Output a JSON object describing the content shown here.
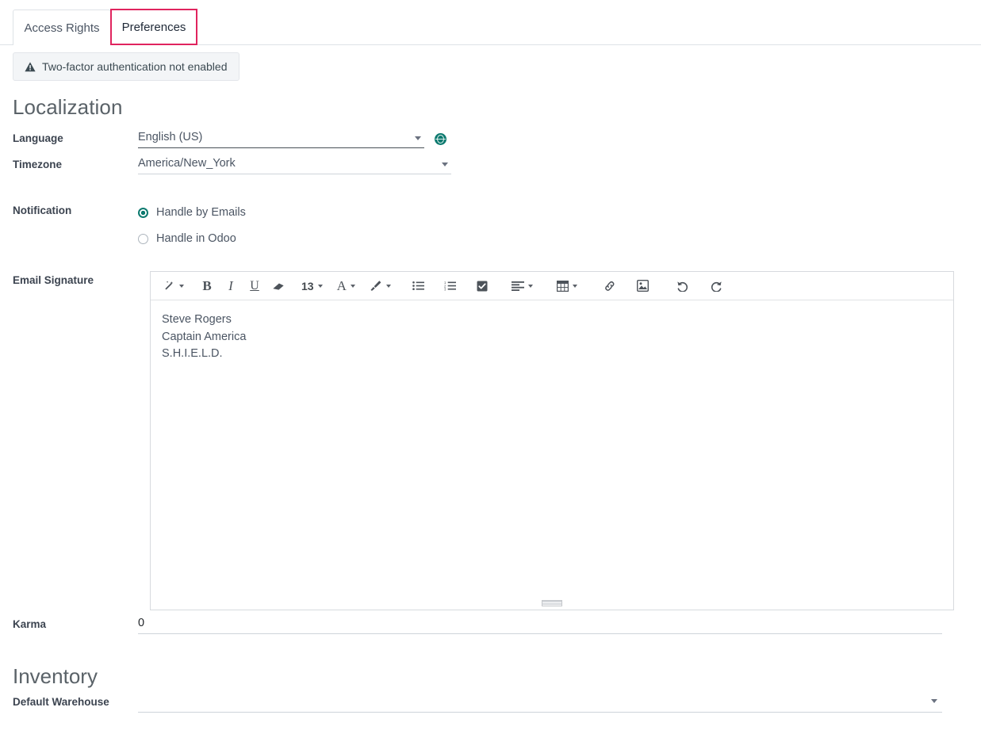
{
  "tabs": [
    {
      "label": "Access Rights",
      "active": false,
      "name": "tab-access-rights"
    },
    {
      "label": "Preferences",
      "active": true,
      "name": "tab-preferences"
    }
  ],
  "twofa": {
    "label": "Two-factor authentication not enabled",
    "icon": "warning-triangle-icon"
  },
  "localization": {
    "title": "Localization",
    "language": {
      "label": "Language",
      "value": "English (US)",
      "icon": "globe-icon"
    },
    "timezone": {
      "label": "Timezone",
      "value": "America/New_York"
    },
    "notification": {
      "label": "Notification",
      "options": [
        {
          "label": "Handle by Emails",
          "selected": true
        },
        {
          "label": "Handle in Odoo",
          "selected": false
        }
      ]
    },
    "email_signature": {
      "label": "Email Signature",
      "lines": [
        "Steve Rogers",
        "Captain America",
        "S.H.I.E.L.D."
      ]
    },
    "karma": {
      "label": "Karma",
      "value": "0"
    }
  },
  "editor_toolbar": {
    "items": [
      {
        "name": "magic-wand-icon",
        "glyph": "✒",
        "caret": true,
        "kind": "icon-wand"
      },
      {
        "name": "bold-button",
        "glyph": "B",
        "caret": false,
        "kind": "bold"
      },
      {
        "name": "italic-button",
        "glyph": "I",
        "caret": false,
        "kind": "italic"
      },
      {
        "name": "underline-button",
        "glyph": "U",
        "caret": false,
        "kind": "underline"
      },
      {
        "name": "remove-format-eraser-icon",
        "glyph": "",
        "caret": false,
        "kind": "eraser"
      },
      {
        "name": "font-size-selector",
        "glyph": "13",
        "caret": true,
        "kind": "size"
      },
      {
        "name": "font-color-button",
        "glyph": "A",
        "caret": true,
        "kind": "fontcolor"
      },
      {
        "name": "background-color-brush-icon",
        "glyph": "",
        "caret": true,
        "kind": "brush"
      },
      {
        "name": "bullet-list-button",
        "glyph": "",
        "caret": false,
        "kind": "ul"
      },
      {
        "name": "numbered-list-button",
        "glyph": "",
        "caret": false,
        "kind": "ol"
      },
      {
        "name": "checklist-button",
        "glyph": "",
        "caret": false,
        "kind": "check"
      },
      {
        "name": "align-left-button",
        "glyph": "",
        "caret": true,
        "kind": "align"
      },
      {
        "name": "table-button",
        "glyph": "",
        "caret": true,
        "kind": "table"
      },
      {
        "name": "insert-link-icon",
        "glyph": "",
        "caret": false,
        "kind": "link"
      },
      {
        "name": "insert-image-icon",
        "glyph": "",
        "caret": false,
        "kind": "image"
      },
      {
        "name": "undo-button",
        "glyph": "",
        "caret": false,
        "kind": "undo"
      },
      {
        "name": "redo-button",
        "glyph": "",
        "caret": false,
        "kind": "redo"
      }
    ],
    "font_size_value": "13"
  },
  "inventory": {
    "title": "Inventory",
    "default_warehouse": {
      "label": "Default Warehouse",
      "value": ""
    }
  },
  "colors": {
    "accent_teal": "#0d7a6f",
    "annotation_red": "#e0245e",
    "heading_gray": "#5a6268",
    "label_dark": "#3c4450",
    "border_light": "#ced4da"
  }
}
